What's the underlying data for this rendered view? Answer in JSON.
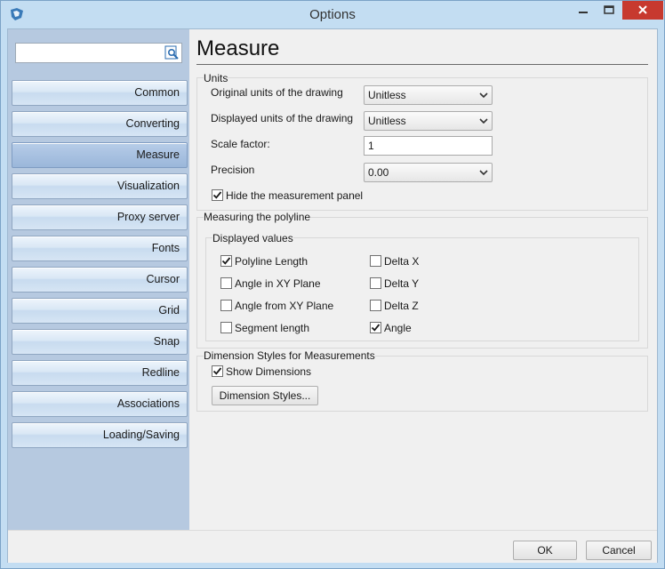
{
  "window": {
    "title": "Options",
    "controls": {
      "minimize": "minimize-icon",
      "maximize": "maximize-icon",
      "close": "close-icon"
    }
  },
  "sidebar": {
    "search": {
      "value": "",
      "placeholder": "",
      "icon": "search-icon"
    },
    "items": [
      {
        "label": "Common"
      },
      {
        "label": "Converting"
      },
      {
        "label": "Measure",
        "active": true
      },
      {
        "label": "Visualization"
      },
      {
        "label": "Proxy server"
      },
      {
        "label": "Fonts"
      },
      {
        "label": "Cursor"
      },
      {
        "label": "Grid"
      },
      {
        "label": "Snap"
      },
      {
        "label": "Redline"
      },
      {
        "label": "Associations"
      },
      {
        "label": "Loading/Saving"
      }
    ]
  },
  "page": {
    "title": "Measure",
    "units": {
      "legend": "Units",
      "original_label": "Original units of the drawing",
      "original_value": "Unitless",
      "displayed_label": "Displayed units of the drawing",
      "displayed_value": "Unitless",
      "scale_label": "Scale factor:",
      "scale_value": "1",
      "precision_label": "Precision",
      "precision_value": "0.00",
      "hide_panel_label": "Hide the measurement panel",
      "hide_panel_checked": true
    },
    "polyline": {
      "legend": "Measuring the polyline",
      "displayed_legend": "Displayed values",
      "options": [
        {
          "label": "Polyline Length",
          "checked": true
        },
        {
          "label": "Angle in XY Plane",
          "checked": false
        },
        {
          "label": "Angle from XY Plane",
          "checked": false
        },
        {
          "label": "Segment length",
          "checked": false
        },
        {
          "label": "Delta X",
          "checked": false
        },
        {
          "label": "Delta Y",
          "checked": false
        },
        {
          "label": "Delta Z",
          "checked": false
        },
        {
          "label": "Angle",
          "checked": true
        }
      ]
    },
    "dimensions": {
      "legend": "Dimension Styles for Measurements",
      "show_label": "Show Dimensions",
      "show_checked": true,
      "styles_button": "Dimension Styles..."
    }
  },
  "footer": {
    "ok": "OK",
    "cancel": "Cancel"
  },
  "colors": {
    "titlebar": "#c3ddf2",
    "sidebar": "#b6c9e0",
    "close": "#c7392f",
    "active_item": "#a8c1e1"
  }
}
